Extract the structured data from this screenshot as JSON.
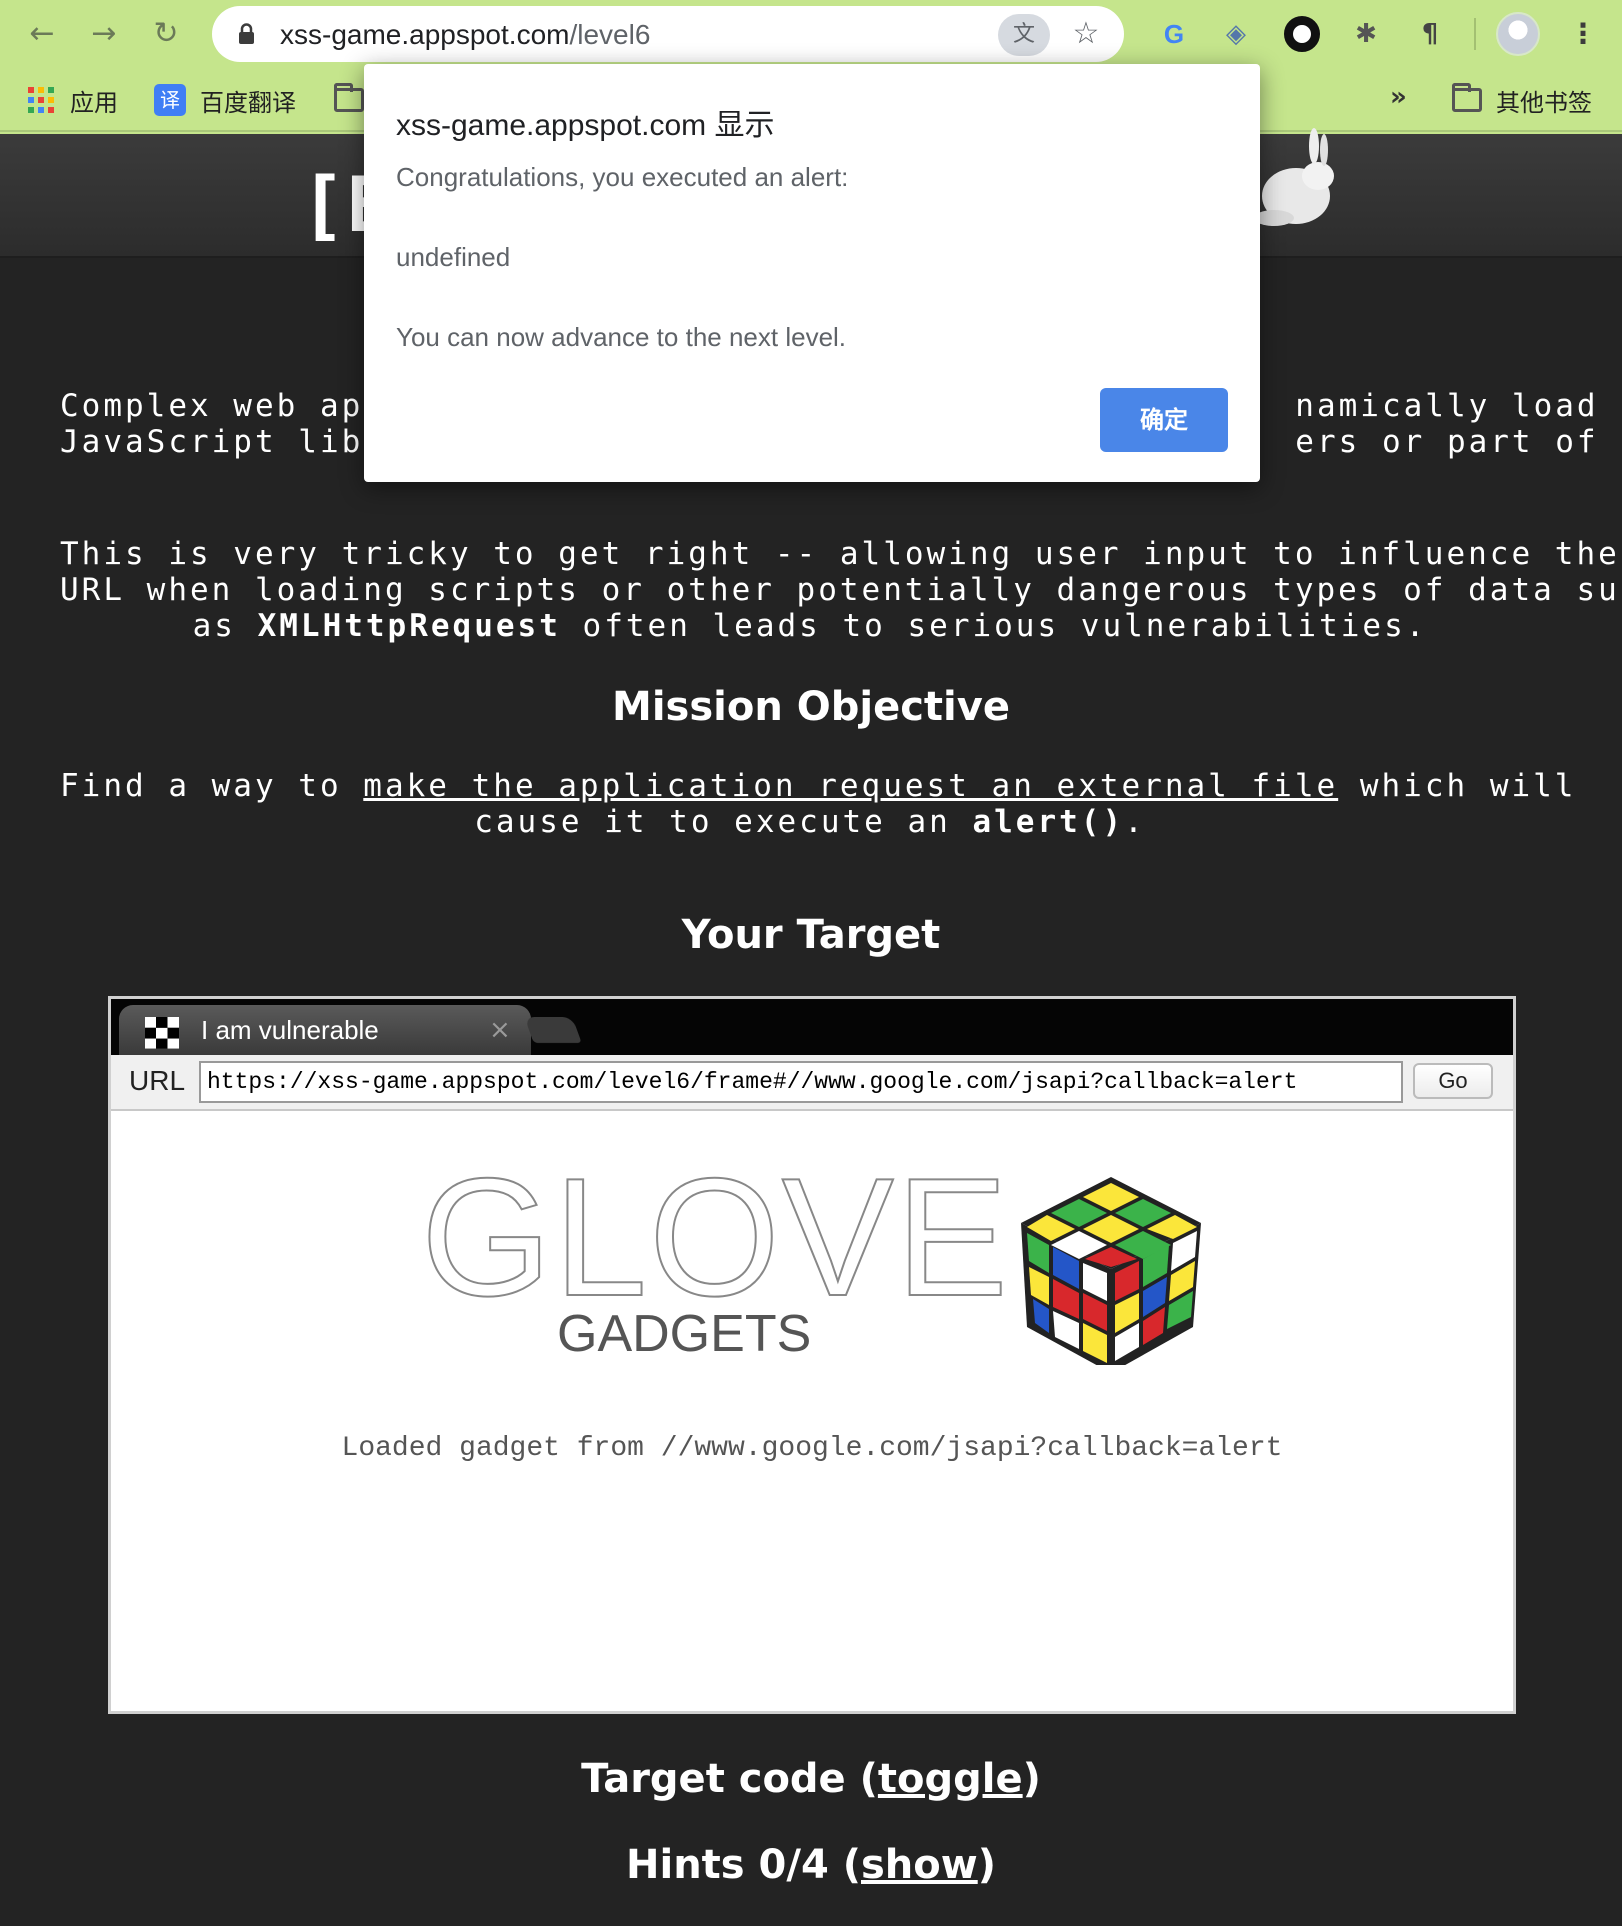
{
  "browser": {
    "url_host": "xss-game.appspot.com",
    "url_path": "/level6",
    "bookmarks": [
      {
        "label": "应用"
      },
      {
        "label": "百度翻译",
        "icon_text": "译"
      }
    ],
    "bookmarks_more": "»",
    "other_bookmarks": "其他书签"
  },
  "page": {
    "logo_partial": "[E",
    "intro_line1_left": "Complex web ap",
    "intro_line1_right": "namically load",
    "intro_line2_left": "JavaScript lib",
    "intro_line2_right": "ers or part of",
    "intro2_line1": "This is very tricky to get right -- allowing user input to influence the",
    "intro2_line2": "URL when loading scripts or other potentially dangerous types of data such",
    "intro2_line3_pre": "as ",
    "intro2_line3_bold": "XMLHttpRequest",
    "intro2_line3_post": " often leads to serious vulnerabilities.",
    "mission_title": "Mission Objective",
    "mission_pre": "Find a way to ",
    "mission_link": "make the application request an external file",
    "mission_post": " which will",
    "mission_line2_pre": "cause it to execute an ",
    "mission_line2_bold": "alert()",
    "mission_line2_post": ".",
    "target_title": "Your Target",
    "target_code_pre": "Target code (",
    "target_code_link": "toggle",
    "target_code_post": ")",
    "hints_pre": "Hints 0/4 (",
    "hints_link": "show",
    "hints_post": ")"
  },
  "frame": {
    "tab_title": "I am vulnerable",
    "tab_close": "×",
    "url_label": "URL",
    "url_value": "https://xss-game.appspot.com/level6/frame#//www.google.com/jsapi?callback=alert",
    "go_label": "Go",
    "logo_word": "GLOVE",
    "logo_sub": "GADGETS",
    "loaded_message": "Loaded gadget from //www.google.com/jsapi?callback=alert"
  },
  "dialog": {
    "title": "xss-game.appspot.com 显示",
    "line1": "Congratulations, you executed an alert:",
    "line2": "undefined",
    "line3": "You can now advance to the next level.",
    "ok_label": "确定"
  },
  "colors": {
    "chrome_bg": "#c5e58c",
    "page_bg": "#232323",
    "dialog_button": "#4a86e8"
  }
}
